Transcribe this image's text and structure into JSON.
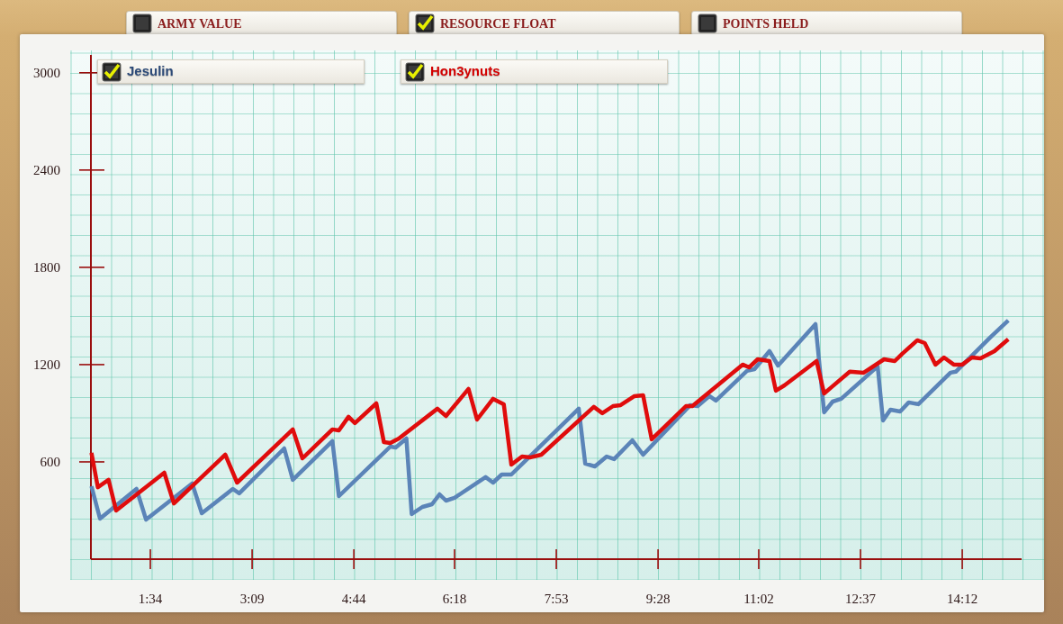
{
  "toggles": [
    {
      "label": "ARMY VALUE",
      "checked": false
    },
    {
      "label": "RESOURCE FLOAT",
      "checked": true
    },
    {
      "label": "POINTS HELD",
      "checked": false
    }
  ],
  "legend": [
    {
      "checked": true,
      "color": "#2c4a78"
    },
    {
      "checked": true,
      "color": "#d40000"
    }
  ],
  "chart_data": {
    "type": "line",
    "xlim": [
      38.5,
      907.4
    ],
    "ylim": [
      0,
      3110
    ],
    "yticks": [
      600,
      1200,
      1800,
      2400,
      3000
    ],
    "xticks": [
      {
        "value": 94,
        "label": "1:34"
      },
      {
        "value": 189,
        "label": "3:09"
      },
      {
        "value": 284,
        "label": "4:44"
      },
      {
        "value": 378,
        "label": "6:18"
      },
      {
        "value": 473,
        "label": "7:53"
      },
      {
        "value": 568,
        "label": "9:28"
      },
      {
        "value": 662,
        "label": "11:02"
      },
      {
        "value": 757,
        "label": "12:37"
      },
      {
        "value": 852,
        "label": "14:12"
      }
    ],
    "series": [
      {
        "name": "Jesulin",
        "color": "#5b84b8",
        "x": [
          39,
          47,
          81,
          90,
          133,
          142,
          171,
          177,
          219,
          227,
          264,
          270,
          318,
          323,
          333,
          338,
          348,
          357,
          364,
          370,
          378,
          407,
          414,
          422,
          431,
          494,
          500,
          509,
          520,
          527,
          544,
          554,
          590,
          598,
          605,
          616,
          622,
          651,
          658,
          672,
          680,
          715,
          723,
          731,
          739,
          773,
          778,
          785,
          794,
          802,
          811,
          841,
          846,
          878,
          895
        ],
        "values": [
          450,
          250,
          433,
          244,
          467,
          283,
          433,
          406,
          683,
          489,
          728,
          389,
          694,
          689,
          744,
          278,
          322,
          339,
          400,
          361,
          378,
          506,
          472,
          522,
          522,
          928,
          589,
          572,
          633,
          617,
          733,
          644,
          894,
          950,
          944,
          1006,
          978,
          1161,
          1172,
          1283,
          1194,
          1450,
          906,
          972,
          989,
          1189,
          856,
          922,
          911,
          967,
          956,
          1150,
          1156,
          1367,
          1472
        ]
      },
      {
        "name": "Hon3ynuts",
        "color": "#e00c0c",
        "x": [
          39,
          45,
          55,
          62,
          107,
          116,
          164,
          175,
          227,
          236,
          264,
          270,
          279,
          285,
          305,
          312,
          318,
          326,
          362,
          370,
          391,
          399,
          414,
          424,
          431,
          441,
          449,
          459,
          508,
          516,
          526,
          533,
          546,
          554,
          562,
          594,
          600,
          647,
          653,
          661,
          672,
          678,
          686,
          716,
          723,
          731,
          747,
          760,
          779,
          789,
          796,
          810,
          817,
          827,
          835,
          844,
          852,
          861,
          869,
          882,
          895
        ],
        "values": [
          656,
          444,
          489,
          300,
          533,
          344,
          644,
          472,
          800,
          622,
          800,
          794,
          878,
          839,
          961,
          722,
          717,
          744,
          928,
          883,
          1050,
          861,
          989,
          956,
          583,
          633,
          628,
          644,
          939,
          900,
          944,
          950,
          1006,
          1011,
          739,
          944,
          944,
          1200,
          1183,
          1233,
          1222,
          1039,
          1072,
          1222,
          1022,
          1067,
          1156,
          1150,
          1233,
          1222,
          1267,
          1350,
          1333,
          1200,
          1244,
          1200,
          1200,
          1244,
          1239,
          1283,
          1356
        ]
      }
    ]
  }
}
